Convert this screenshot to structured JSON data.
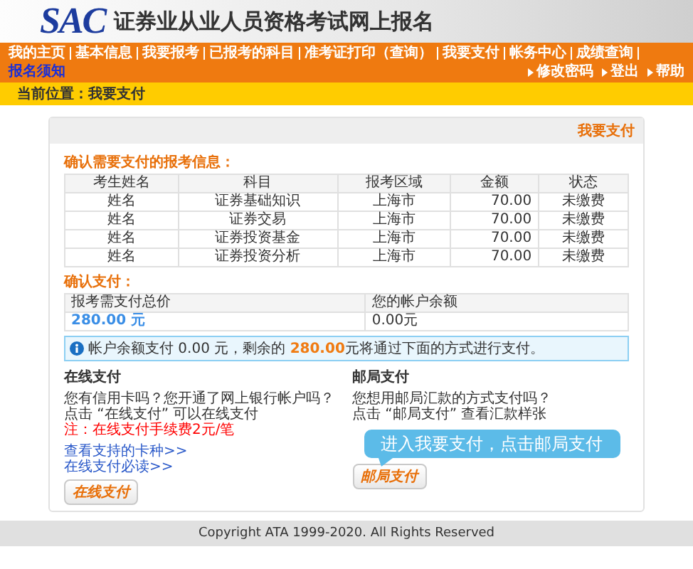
{
  "header": {
    "logo": "SAC",
    "title": "证券业从业人员资格考试网上报名"
  },
  "nav": {
    "items": [
      {
        "label": "我的主页",
        "highlighted": false
      },
      {
        "label": "基本信息",
        "highlighted": false
      },
      {
        "label": "我要报考",
        "highlighted": false
      },
      {
        "label": "已报考的科目",
        "highlighted": false
      },
      {
        "label": "准考证打印（查询）",
        "highlighted": false
      },
      {
        "label": "我要支付",
        "highlighted": false
      },
      {
        "label": "帐务中心",
        "highlighted": false
      },
      {
        "label": "成绩查询",
        "highlighted": false
      },
      {
        "label": "报名须知",
        "highlighted": true
      }
    ],
    "user_links": [
      "修改密码",
      "登出",
      "帮助"
    ]
  },
  "breadcrumb": "当前位置：我要支付",
  "panel": {
    "title": "我要支付",
    "exam_section": {
      "heading": "确认需要支付的报考信息：",
      "columns": [
        "考生姓名",
        "科目",
        "报考区域",
        "金额",
        "状态"
      ],
      "rows": [
        [
          "姓名",
          "证券基础知识",
          "上海市",
          "70.00",
          "未缴费"
        ],
        [
          "姓名",
          "证券交易",
          "上海市",
          "70.00",
          "未缴费"
        ],
        [
          "姓名",
          "证券投资基金",
          "上海市",
          "70.00",
          "未缴费"
        ],
        [
          "姓名",
          "证券投资分析",
          "上海市",
          "70.00",
          "未缴费"
        ]
      ]
    },
    "confirm_section": {
      "heading": "确认支付：",
      "columns": [
        "报考需支付总价",
        "您的帐户余额"
      ],
      "values": [
        "280.00 元",
        "0.00元"
      ]
    },
    "notice": "帐户余额支付 0.00 元，剩余的 **280.00**元将通过下面的方式进行支付。",
    "methods": [
      {
        "title": "在线支付",
        "lines": [
          "您有信用卡吗？您开通了网上银行帐户吗？",
          "点击 “在线支付” 可以在线支付"
        ],
        "note": "注：在线支付手续费2元/笔",
        "links": [
          "查看支持的卡种>>",
          "在线支付必读>>"
        ],
        "button": "在线支付"
      },
      {
        "title": "邮局支付",
        "lines": [
          "您想用邮局汇款的方式支付吗？",
          "点击 “邮局支付” 查看汇款样张"
        ],
        "button": "邮局支付",
        "tooltip": "进入我要支付，点击邮局支付"
      }
    ]
  },
  "footer": "Copyright ATA 1999-2020. All Rights Reserved"
}
